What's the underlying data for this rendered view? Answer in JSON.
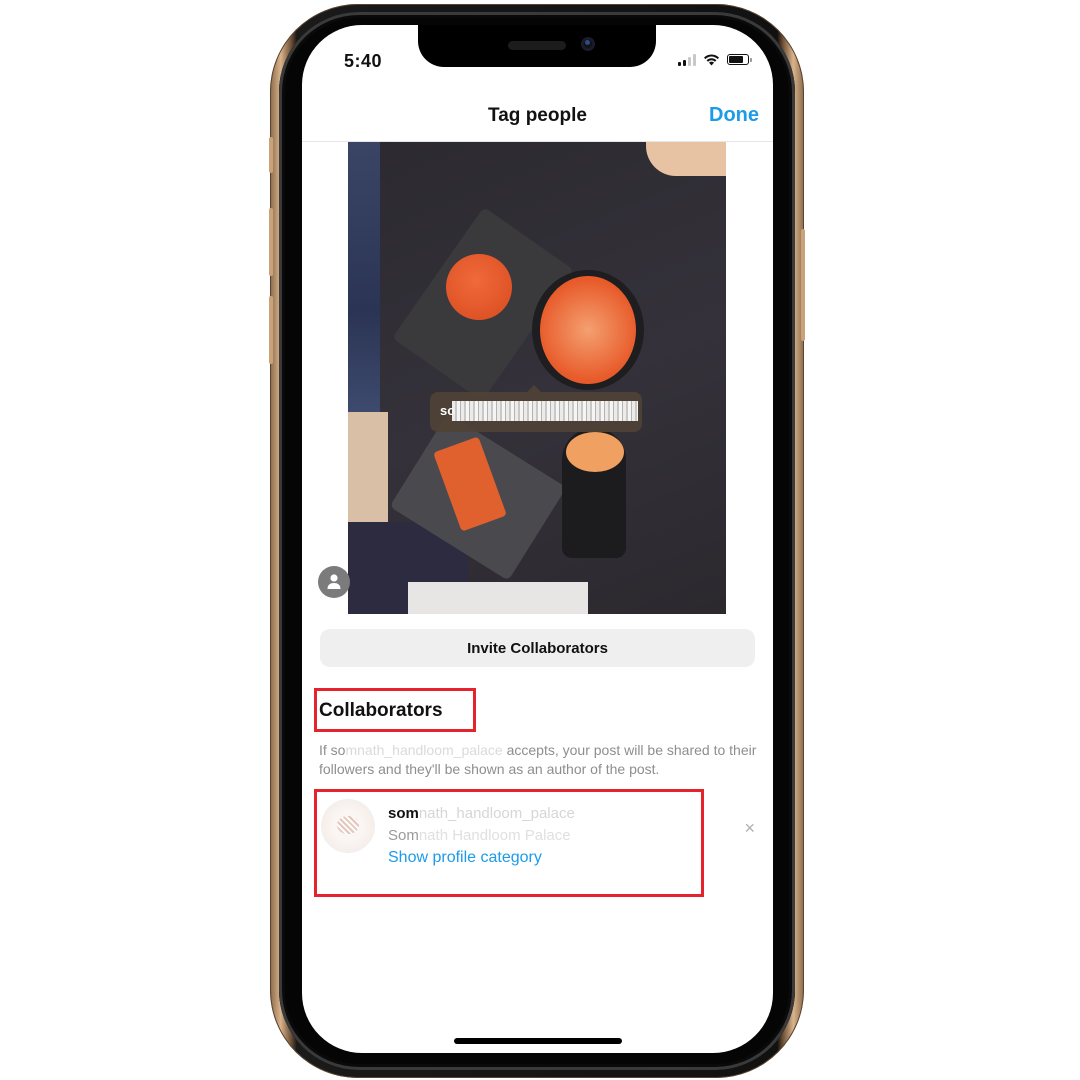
{
  "status_bar": {
    "time": "5:40",
    "icons": [
      "cellular-signal-icon",
      "wifi-icon",
      "battery-icon"
    ]
  },
  "nav": {
    "title": "Tag people",
    "done_label": "Done"
  },
  "photo": {
    "tag_label_visible": "so",
    "tag_label_obscured": true
  },
  "invite_button": {
    "label": "Invite Collaborators"
  },
  "collaborators": {
    "heading": "Collaborators",
    "description_prefix": "If so",
    "description_name_obscured": "mnath_handloom_palace",
    "description_suffix": " accepts, your post will be shared to their followers and they'll be shown as an author of the post.",
    "items": [
      {
        "username_visible": "som",
        "username_obscured": "nath_handloom_palace",
        "fullname_visible": "Som",
        "fullname_obscured": "nath Handloom Palace",
        "link_label": "Show profile category",
        "remove_icon": "×"
      }
    ]
  },
  "colors": {
    "accent": "#1c9be8",
    "highlight_box": "#e4232c",
    "secondary_text": "#8e8e8e",
    "button_bg": "#efefef"
  }
}
